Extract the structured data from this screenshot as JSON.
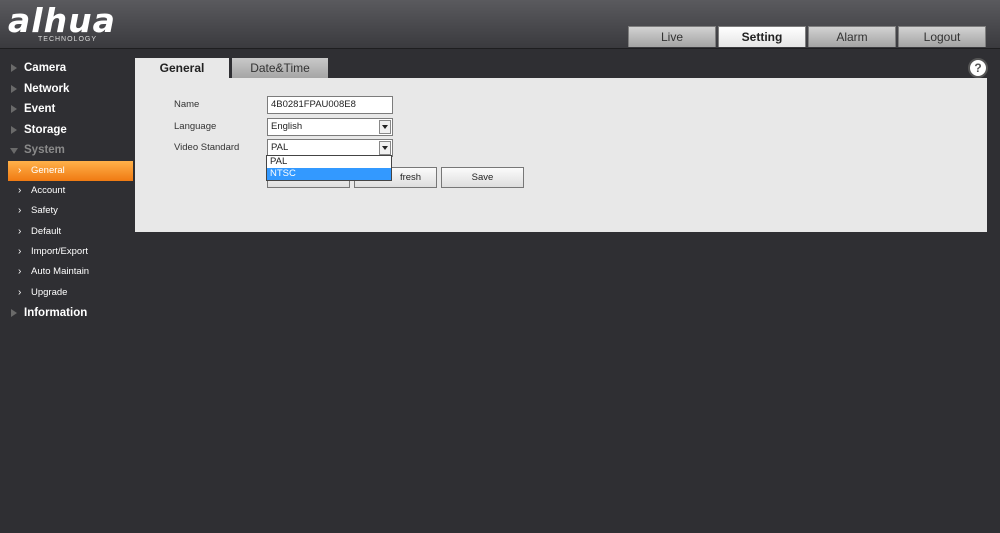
{
  "brand": {
    "logo": "alhua",
    "logo_sub": "TECHNOLOGY"
  },
  "topnav": [
    "Live",
    "Setting",
    "Alarm",
    "Logout"
  ],
  "sidebar": {
    "camera": "Camera",
    "network": "Network",
    "event": "Event",
    "storage": "Storage",
    "system": "System",
    "system_items": [
      "General",
      "Account",
      "Safety",
      "Default",
      "Import/Export",
      "Auto Maintain",
      "Upgrade"
    ],
    "information": "Information"
  },
  "content_tabs": [
    "General",
    "Date&Time"
  ],
  "help": "?",
  "form": {
    "name_label": "Name",
    "name_value": "4B0281FPAU008E8",
    "language_label": "Language",
    "language_value": "English",
    "video_label": "Video Standard",
    "video_value": "PAL",
    "video_options": [
      "PAL",
      "NTSC"
    ],
    "refresh_label_visible": "fresh",
    "save_label": "Save"
  },
  "colors": {
    "accent": "#f07a12",
    "highlight": "#3399ff",
    "background": "#2f2f33"
  }
}
